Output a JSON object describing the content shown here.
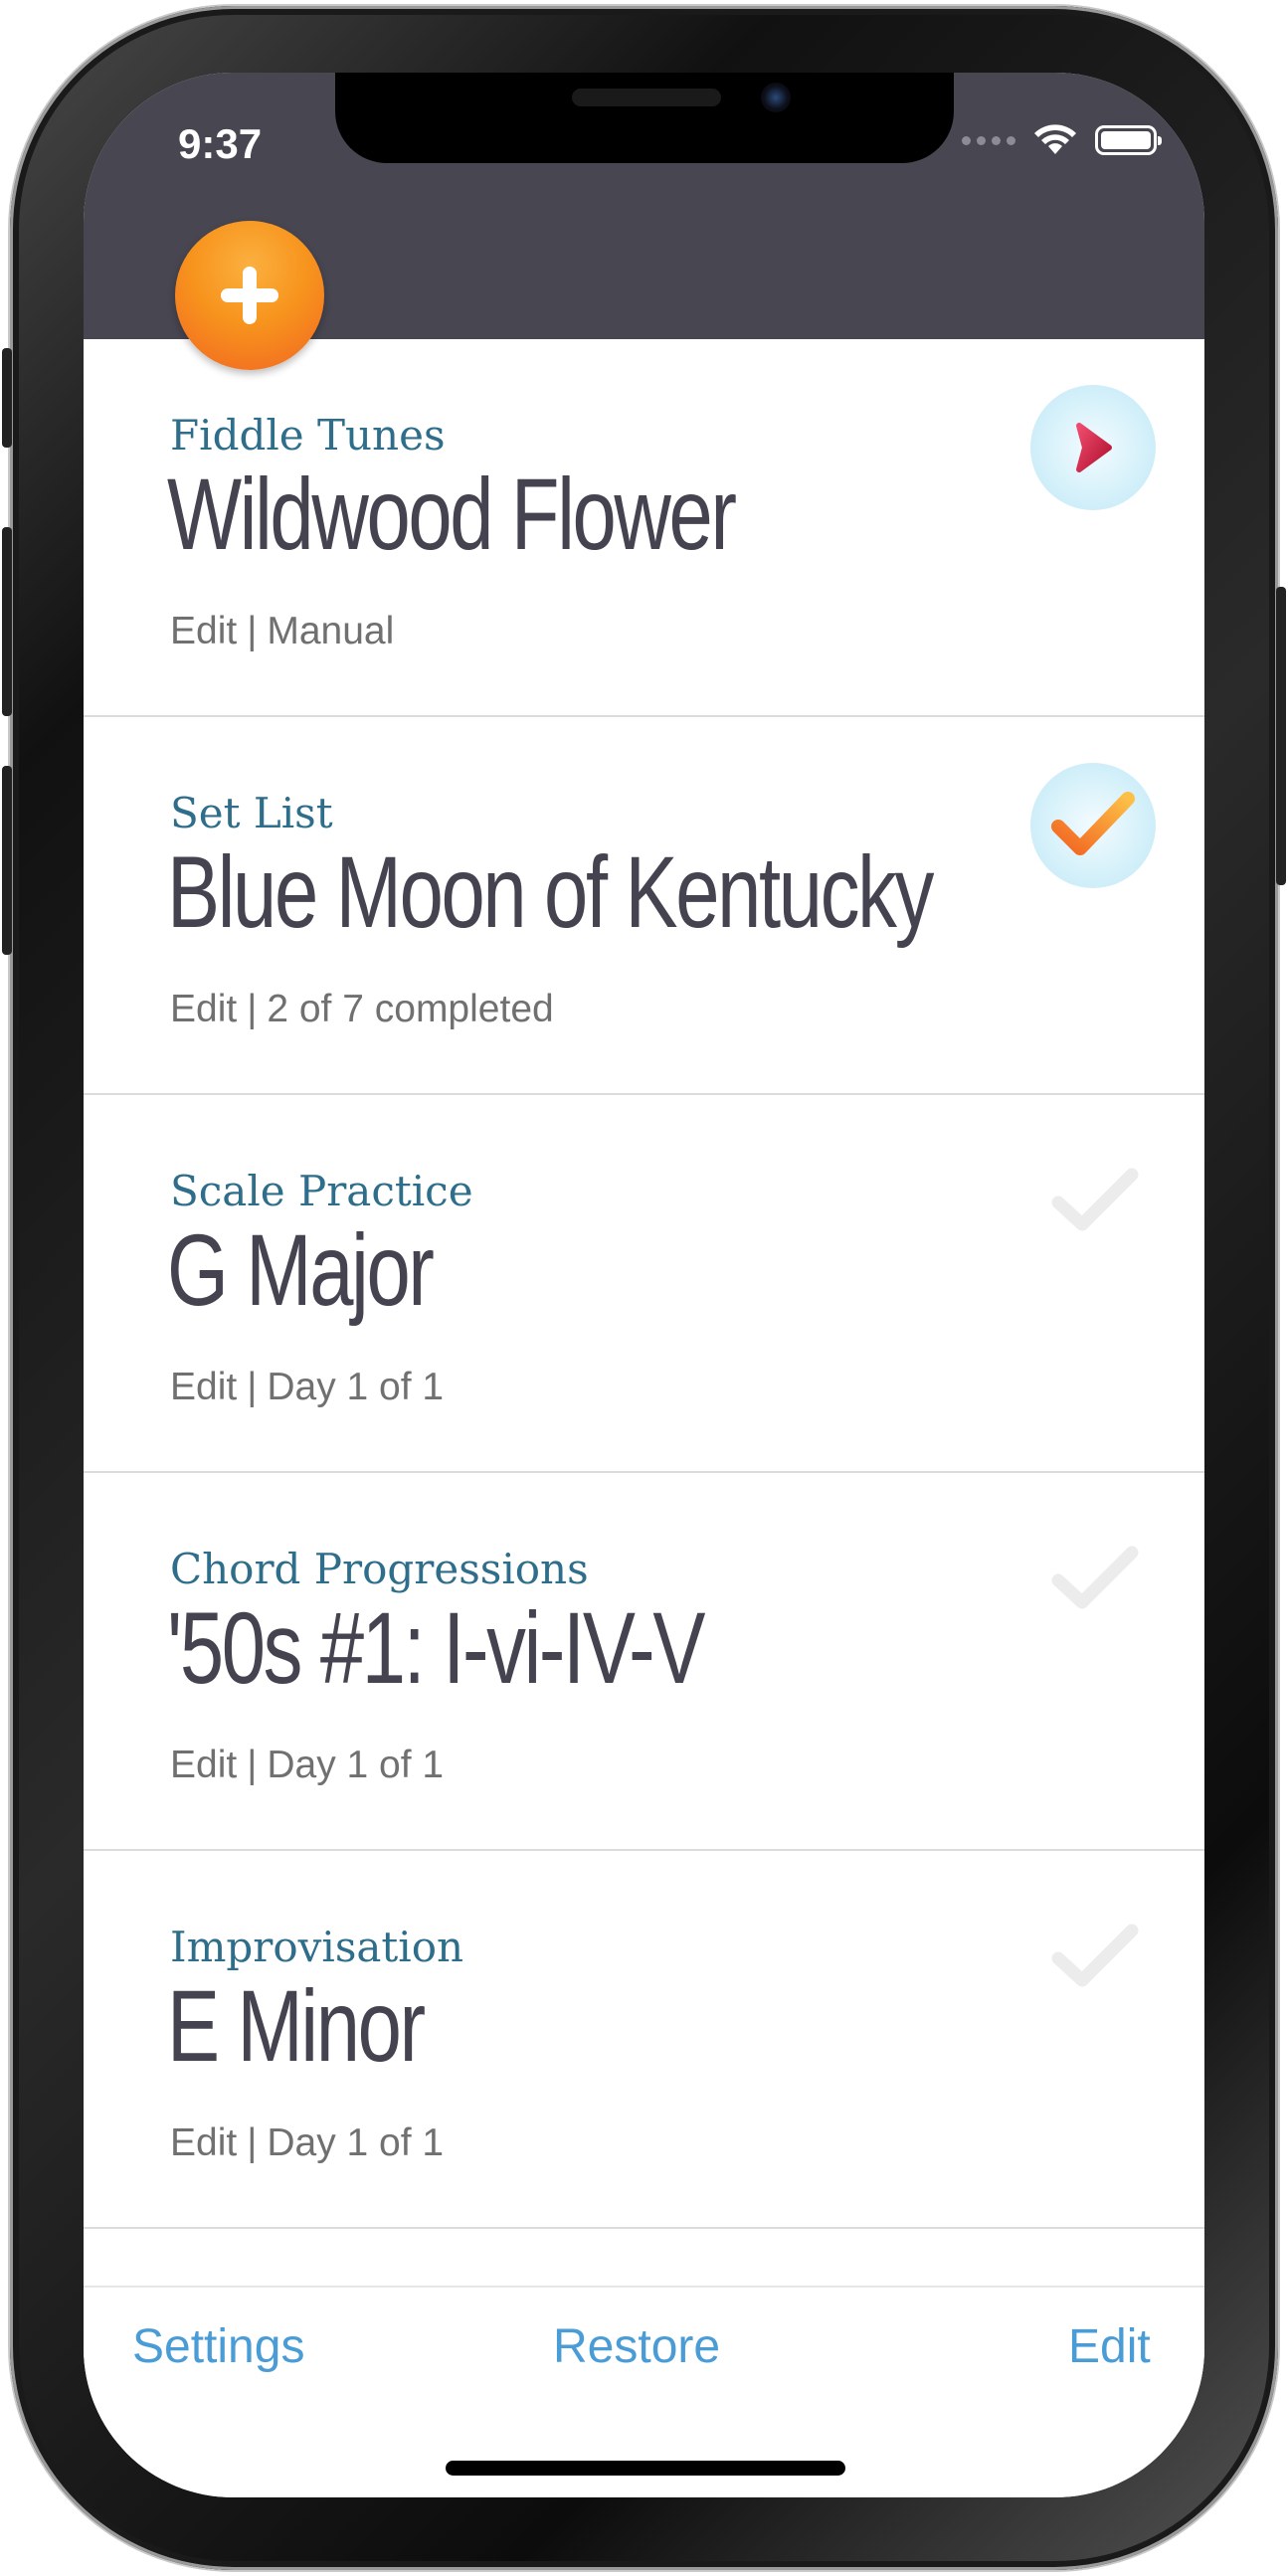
{
  "status_bar": {
    "time": "9:37"
  },
  "header": {
    "add_button_label": "+"
  },
  "rows": [
    {
      "category": "Fiddle Tunes",
      "title": "Wildwood Flower",
      "edit": "Edit",
      "separator": "|",
      "detail": "Manual",
      "icon": "play-arrow-icon"
    },
    {
      "category": "Set List",
      "title": "Blue Moon of Kentucky",
      "edit": "Edit",
      "separator": "|",
      "detail": "2 of 7 completed",
      "icon": "checkmark-icon"
    },
    {
      "category": "Scale Practice",
      "title": "G Major",
      "edit": "Edit",
      "separator": "|",
      "detail": "Day 1 of 1",
      "icon": "faint-checkmark-icon"
    },
    {
      "category": "Chord Progressions",
      "title": "'50s #1:  I-vi-IV-V",
      "edit": "Edit",
      "separator": "|",
      "detail": "Day 1 of 1",
      "icon": "faint-checkmark-icon"
    },
    {
      "category": "Improvisation",
      "title": "E Minor",
      "edit": "Edit",
      "separator": "|",
      "detail": "Day 1 of 1",
      "icon": "faint-checkmark-icon"
    }
  ],
  "tabbar": {
    "settings": "Settings",
    "restore": "Restore",
    "edit": "Edit"
  },
  "colors": {
    "header": "#474651",
    "accent_orange": "#f7941d",
    "link_blue": "#4a9cd6",
    "category_blue": "#2f6e8b"
  }
}
